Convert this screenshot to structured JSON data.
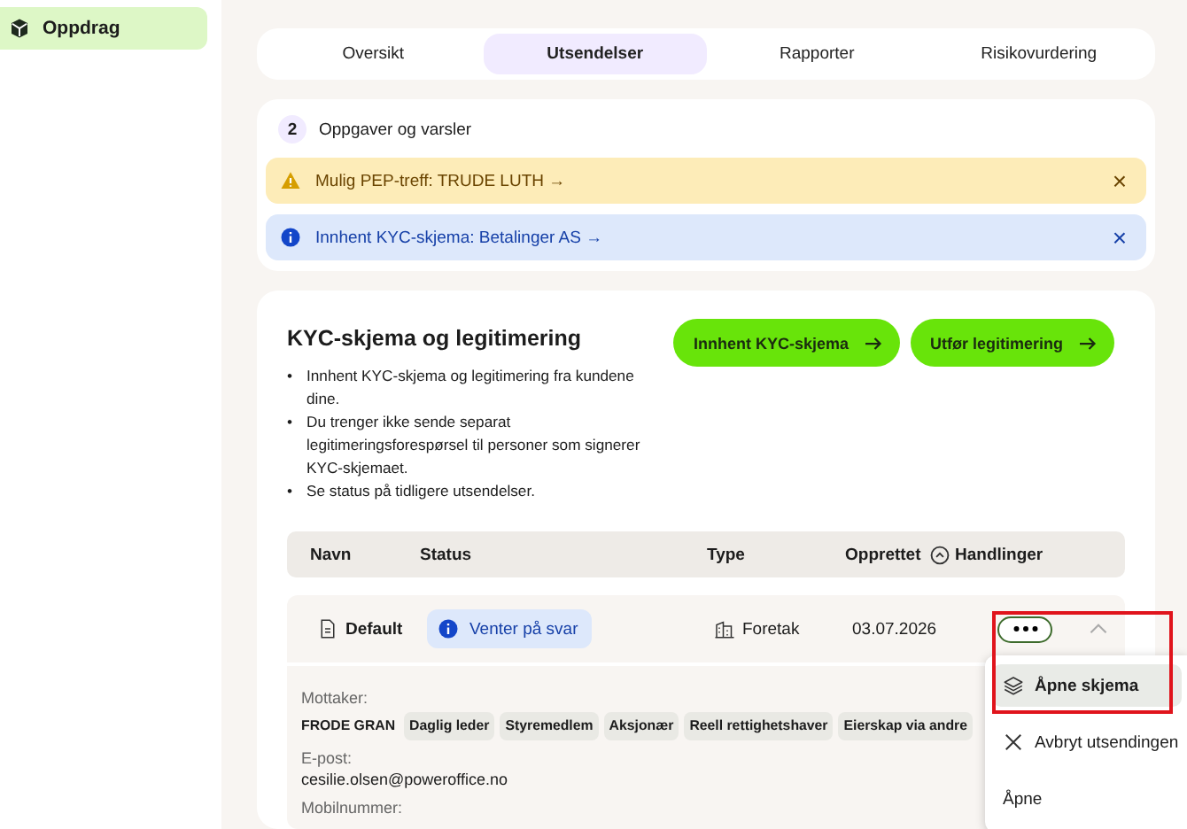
{
  "sidebar": {
    "items": [
      {
        "label": "Oppdrag",
        "selected": true
      }
    ]
  },
  "tabs": [
    {
      "label": "Oversikt",
      "selected": false
    },
    {
      "label": "Utsendelser",
      "selected": true
    },
    {
      "label": "Rapporter",
      "selected": false
    },
    {
      "label": "Risikovurdering",
      "selected": false
    }
  ],
  "tasks": {
    "count": "2",
    "title": "Oppgaver og varsler",
    "alerts": [
      {
        "kind": "warning",
        "text": "Mulig PEP-treff: TRUDE LUTH →",
        "close": "×"
      },
      {
        "kind": "info",
        "text": "Innhent KYC-skjema: Betalinger AS →",
        "close": "×"
      }
    ]
  },
  "kyc": {
    "title": "KYC-skjema og legitimering",
    "bullet_mark": "•",
    "bullets": [
      "Innhent KYC-skjema og legitimering fra kundene dine.",
      "Du trenger ikke sende separat legitimeringsforespørsel til personer som signerer KYC-skjemaet.",
      "Se status på tidligere utsendelser."
    ],
    "buttons": [
      "Innhent KYC-skjema",
      "Utfør legitimering"
    ],
    "columns": [
      {
        "label": "Navn",
        "sortable": false
      },
      {
        "label": "Status",
        "sortable": false
      },
      {
        "label": "Type",
        "sortable": false
      },
      {
        "label": "Opprettet",
        "sortable": true
      },
      {
        "label": "Handlinger",
        "sortable": false
      }
    ],
    "rows": [
      {
        "name": "Default",
        "status": "Venter på svar",
        "type": "Foretak",
        "created": "03.07.2026",
        "expanded": true,
        "recipient_label": "Mottaker:",
        "recipient": "FRODE GRAN",
        "roles": [
          "Daglig leder",
          "Styremedlem",
          "Aksjonær",
          "Reell rettighetshaver",
          "Eierskap via andre"
        ],
        "email_label": "E-post:",
        "email": "cesilie.olsen@poweroffice.no",
        "phone_label": "Mobilnummer:"
      }
    ]
  },
  "menu": {
    "items": [
      {
        "label": "Åpne skjema",
        "selected": true
      },
      {
        "label": "Avbryt utsendingen",
        "selected": false
      },
      {
        "label": "Åpne",
        "selected": false
      }
    ]
  }
}
